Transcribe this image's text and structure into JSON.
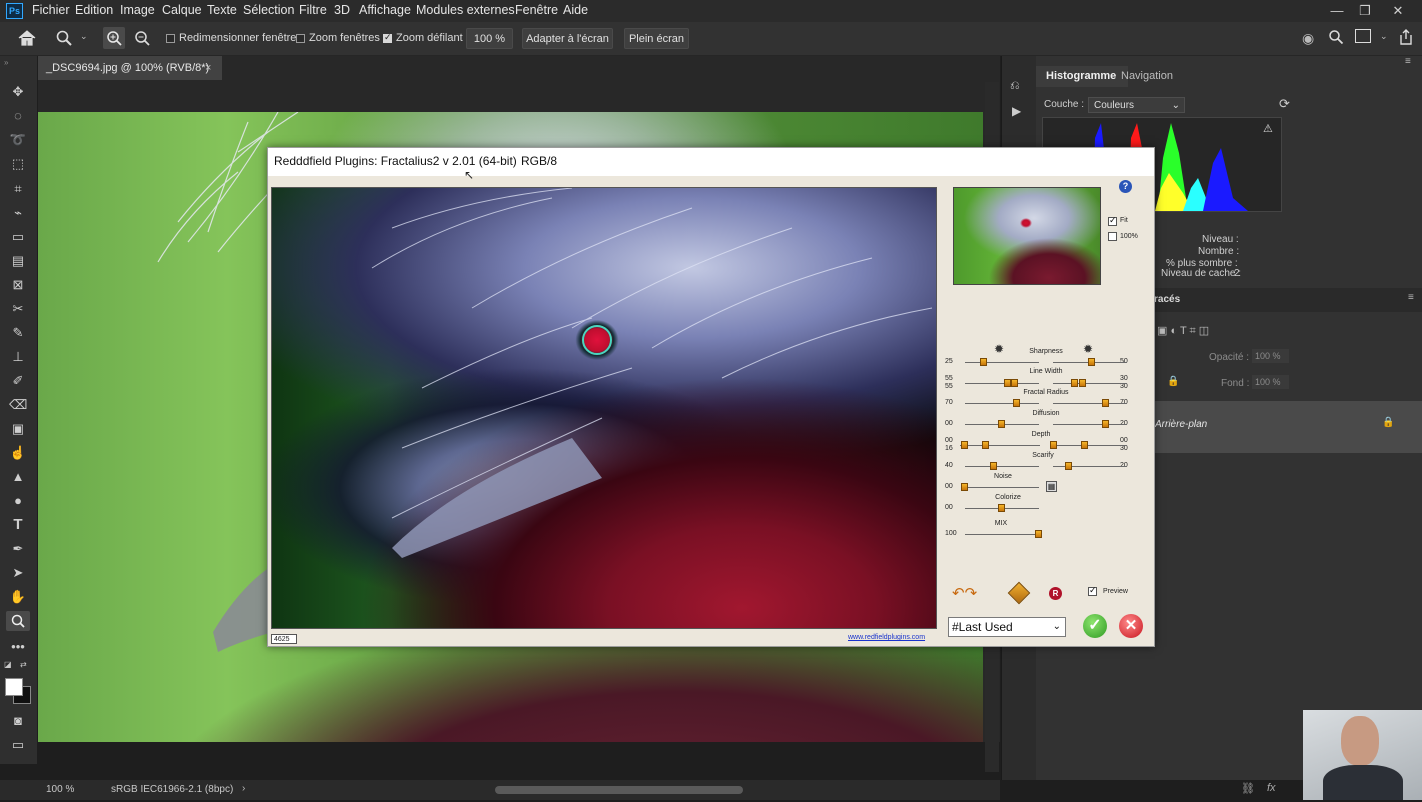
{
  "menubar": {
    "app_icon": "Ps",
    "items": [
      "Fichier",
      "Edition",
      "Image",
      "Calque",
      "Texte",
      "Sélection",
      "Filtre",
      "3D",
      "Affichage",
      "Modules externes",
      "Fenêtre",
      "Aide"
    ]
  },
  "options_bar": {
    "resize_windows": "Redimensionner fenêtres",
    "zoom_windows": "Zoom fenêtres",
    "scrubby_zoom": "Zoom défilant",
    "zoom_value": "100 %",
    "fit_screen": "Adapter à l'écran",
    "full_screen": "Plein écran"
  },
  "document": {
    "tab_title": "_DSC9694.jpg @ 100% (RVB/8*)",
    "close": "×"
  },
  "status": {
    "zoom": "100 %",
    "profile": "sRGB IEC61966-2.1 (8bpc)",
    "arrow": "›"
  },
  "right_panel": {
    "tab_histogram": "Histogramme",
    "tab_navigation": "Navigation",
    "channel_label": "Couche :",
    "channel_value": "Couleurs",
    "info_level": "Niveau :",
    "info_count": "Nombre :",
    "info_darker": "% plus sombre :",
    "info_cache_label": "Niveau de cache :",
    "info_cache_value": "2",
    "layers_tab": "racés",
    "opacity_label": "Opacité :",
    "opacity_value": "100 %",
    "fill_label": "Fond :",
    "fill_value": "100 %",
    "layer_name": "Arrière-plan",
    "histogram_colors": [
      "#1a1aff",
      "#ff1a1a",
      "#2aff2a",
      "#ffff2a",
      "#2affff"
    ]
  },
  "dialog": {
    "title": "Redddfield Plugins: Fractalius2 v 2.01 (64-bit)",
    "mode": "RGB/8",
    "help": "?",
    "fit_label": "Fit",
    "fit_checked": true,
    "zoom100_label": "100%",
    "zoom100_checked": false,
    "preview_label": "Preview",
    "preview_checked": true,
    "counter": "4625",
    "link": "www.redfieldplugins.com",
    "preset": "#Last Used",
    "reset_label": "R",
    "sliders": [
      {
        "label": "Sharpness",
        "left": "25",
        "right": "50",
        "knob1": 0.25,
        "knob2": 0.5
      },
      {
        "label": "Line Width",
        "left1": "55",
        "left2": "55",
        "right1": "30",
        "right2": "30",
        "knob1": 0.55,
        "knob2": 0.3
      },
      {
        "label": "Fractal Radius",
        "left": "70",
        "right": "70",
        "knob1": 0.7,
        "knob2": 0.7
      },
      {
        "label": "Diffusion",
        "left": "00",
        "right": "20",
        "knob1": 0.1,
        "knob2": 0.2
      },
      {
        "label": "Depth",
        "left1": "00",
        "left2": "16",
        "right1": "00",
        "right2": "30",
        "knob1": 0.05,
        "knob2": 0.3
      },
      {
        "label": "Scarify",
        "left": "40",
        "right": "20",
        "knob1": 0.4,
        "knob2": 0.2
      },
      {
        "label": "Noise",
        "left": "00"
      },
      {
        "label": "Colorize",
        "left": "00"
      },
      {
        "label": "MIX",
        "left": "100"
      }
    ]
  },
  "colors": {
    "accent": "#31a8ff",
    "dialog_bg": "#ece7dc",
    "ok_green": "#3aa52b",
    "cancel_red": "#d0202a"
  }
}
